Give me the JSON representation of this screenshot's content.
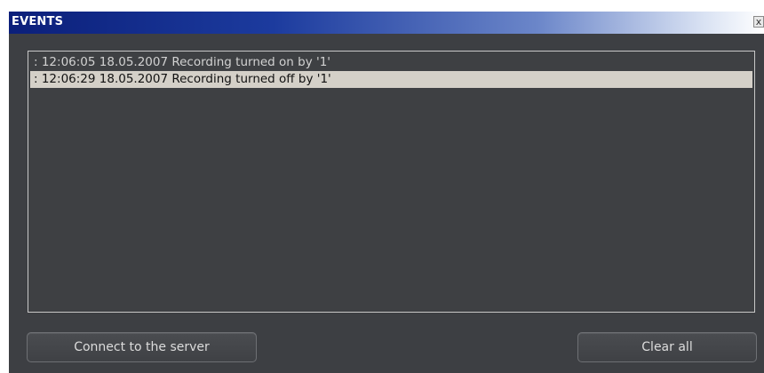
{
  "window": {
    "title": "EVENTS",
    "close_glyph": "x"
  },
  "events": [
    {
      "text": ": 12:06:05 18.05.2007 Recording turned on by '1'",
      "selected": false
    },
    {
      "text": ": 12:06:29 18.05.2007 Recording turned off by '1'",
      "selected": true
    }
  ],
  "buttons": {
    "connect_label": "Connect to the server",
    "clear_label": "Clear all"
  },
  "colors": {
    "titlebar_start": "#0b1f7a",
    "panel_bg": "#3d3f43",
    "selected_row_bg": "#d4d0c8",
    "text_light": "#d2d2d2"
  }
}
